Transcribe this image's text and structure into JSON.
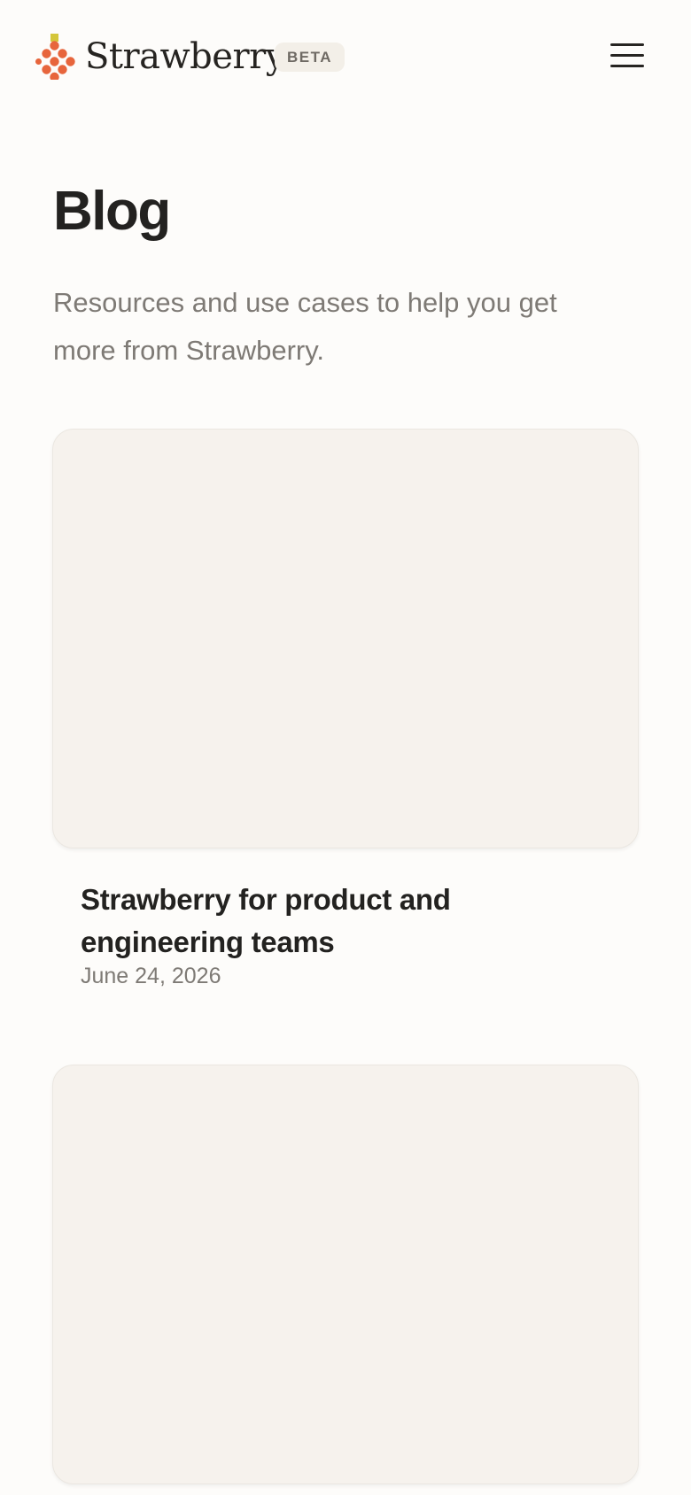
{
  "header": {
    "brand_name": "Strawberry",
    "badge": "BETA",
    "logo_icon": "strawberry-dots-icon",
    "menu_icon": "hamburger-menu-icon",
    "colors": {
      "logo_dots": "#e7653c",
      "logo_leaf": "#d4c63a"
    }
  },
  "main": {
    "title": "Blog",
    "subtitle": "Resources and use cases to help you get more from Strawberry."
  },
  "posts": [
    {
      "title": "Strawberry for product and engineering teams",
      "date": "June 24, 2026"
    },
    {
      "title": "",
      "date": ""
    }
  ],
  "colors": {
    "background": "#fdfcfa",
    "card_placeholder": "#f6f2ed",
    "heading": "#232220",
    "muted_text": "#7e7a75"
  }
}
